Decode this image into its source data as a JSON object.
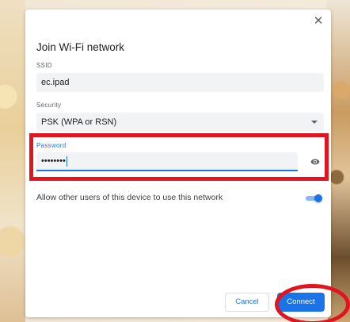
{
  "dialog": {
    "title": "Join Wi-Fi network",
    "close_symbol": "✕",
    "ssid_label": "SSID",
    "ssid_value": "ec.ipad",
    "security_label": "Security",
    "security_value": "PSK (WPA or RSN)",
    "password_label": "Password",
    "password_value": "••••••••",
    "allow_text": "Allow other users of this device to use this network",
    "cancel_label": "Cancel",
    "connect_label": "Connect"
  },
  "colors": {
    "accent": "#1a73e8",
    "highlight": "#e0151f"
  },
  "icons": {
    "close": "close-icon",
    "dropdown": "chevron-down-icon",
    "show_password": "eye-icon"
  }
}
